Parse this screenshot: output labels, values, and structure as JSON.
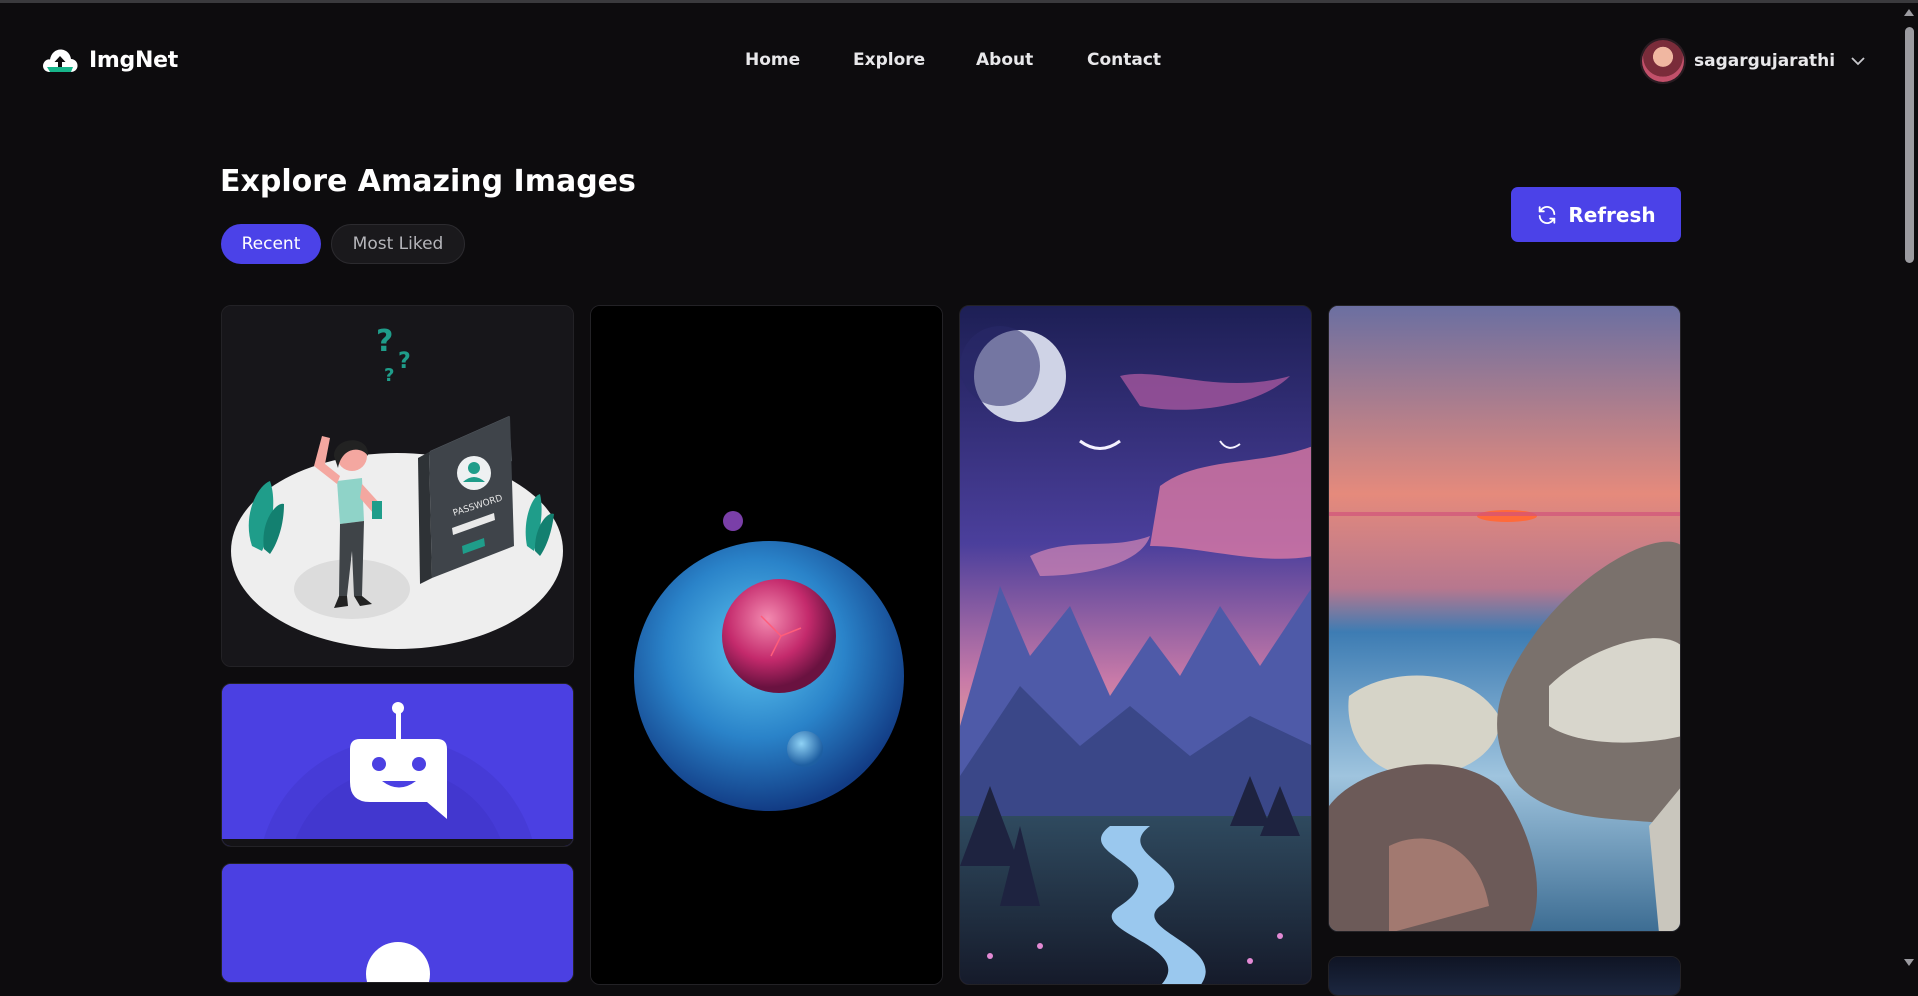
{
  "app": {
    "name": "ImgNet"
  },
  "nav": {
    "links": [
      {
        "label": "Home"
      },
      {
        "label": "Explore"
      },
      {
        "label": "About"
      },
      {
        "label": "Contact"
      }
    ]
  },
  "user": {
    "username": "sagargujarathi"
  },
  "main": {
    "title": "Explore Amazing Images",
    "tabs": [
      {
        "label": "Recent",
        "active": true
      },
      {
        "label": "Most Liked",
        "active": false
      }
    ],
    "refresh_label": "Refresh"
  },
  "colors": {
    "accent": "#4b42e8",
    "background": "#0d0c0e",
    "card_border": "#232226"
  },
  "icons": {
    "logo": "cloud-upload-icon",
    "refresh": "refresh-icon",
    "user_menu": "chevron-down-icon"
  }
}
